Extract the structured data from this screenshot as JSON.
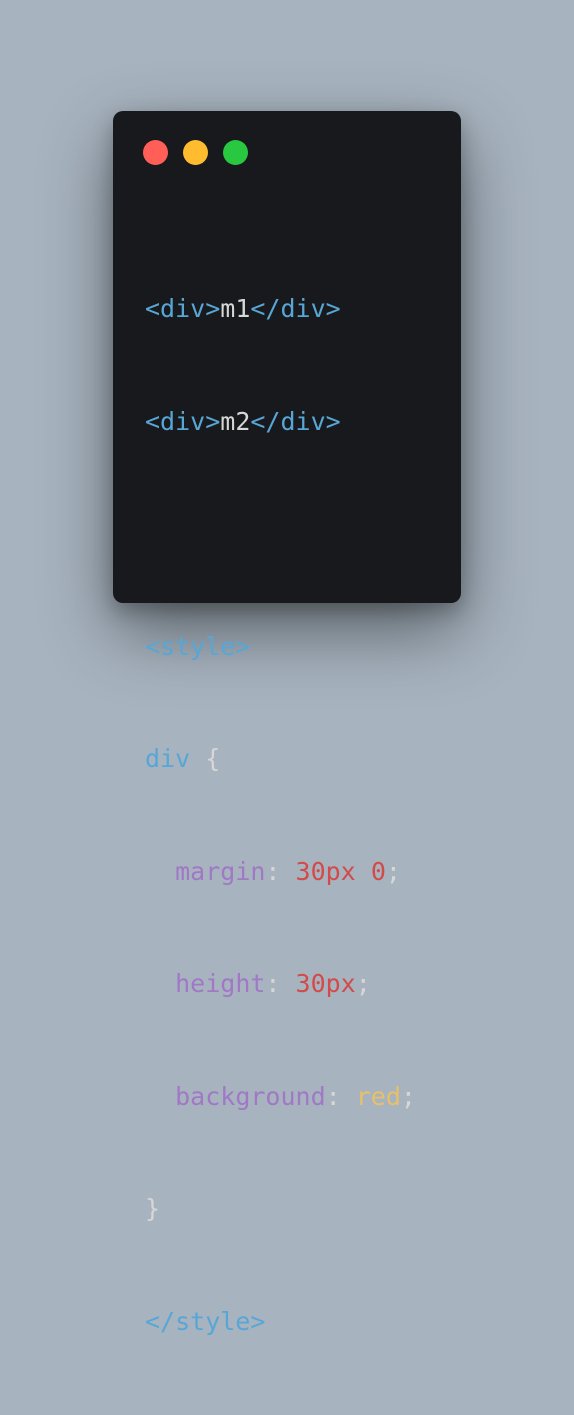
{
  "window": {
    "controls": [
      {
        "name": "close",
        "color": "#ff5f57"
      },
      {
        "name": "minimize",
        "color": "#febc2e"
      },
      {
        "name": "zoom",
        "color": "#28c840"
      }
    ]
  },
  "code": {
    "line1": {
      "open": "<div>",
      "text": "m1",
      "close": "</div>"
    },
    "line2": {
      "open": "<div>",
      "text": "m2",
      "close": "</div>"
    },
    "style_open": "<style>",
    "selector": "div",
    "brace_open": "{",
    "decl1": {
      "prop": "margin",
      "colon": ": ",
      "v1": "30px",
      "space": " ",
      "v2": "0",
      "semi": ";"
    },
    "decl2": {
      "prop": "height",
      "colon": ": ",
      "v1": "30px",
      "semi": ";"
    },
    "decl3": {
      "prop": "background",
      "colon": ": ",
      "v1": "red",
      "semi": ";"
    },
    "brace_close": "}",
    "style_close": "</style>"
  },
  "colors": {
    "background": "#a7b3bf",
    "window": "#17191c",
    "tag": "#58a6d6",
    "property": "#a178c6",
    "number": "#d24b4b",
    "value": "#e8c06a",
    "text": "#d7d7d7"
  }
}
